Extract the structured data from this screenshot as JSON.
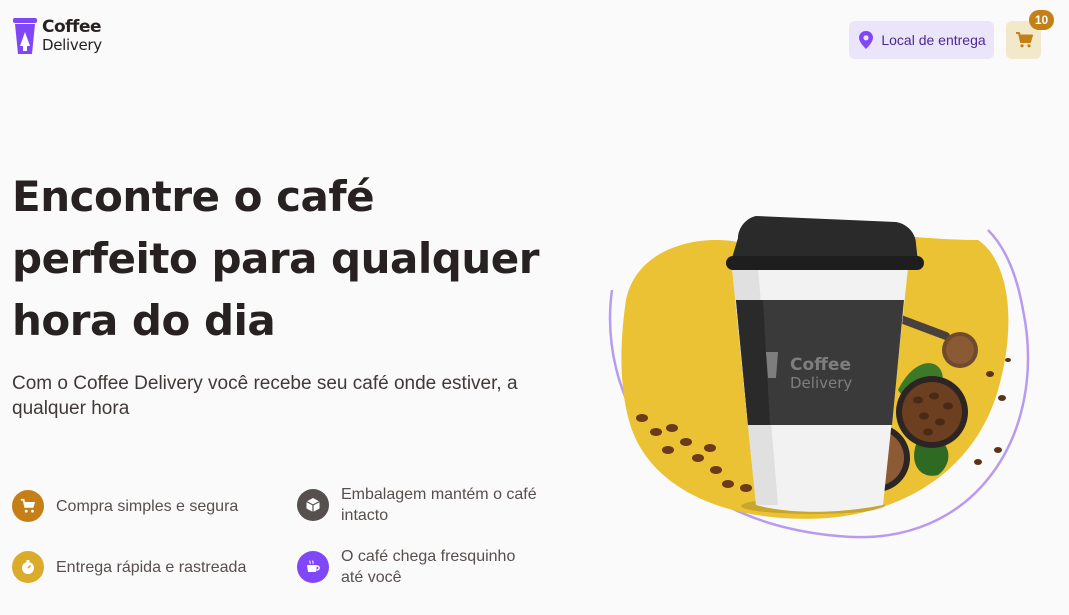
{
  "header": {
    "logo": {
      "line1": "Coffee",
      "line2": "Delivery"
    },
    "location_label": "Local de entrega",
    "cart_count": "10"
  },
  "hero": {
    "title_lines": [
      "Encontre o café",
      "perfeito para qualquer",
      "hora do dia"
    ],
    "subtitle": "Com o Coffee Delivery você recebe seu café onde estiver, a qualquer hora",
    "features": [
      {
        "label": "Compra simples e segura",
        "icon": "cart-icon",
        "color": "#C47F17"
      },
      {
        "label": "Embalagem mantém o café intacto",
        "icon": "package-icon",
        "color": "#574F4D"
      },
      {
        "label": "Entrega rápida e rastreada",
        "icon": "timer-icon",
        "color": "#DBAC2C"
      },
      {
        "label": "O café chega fresquinho até você",
        "icon": "coffee-icon",
        "color": "#8047F8"
      }
    ],
    "image_cup_label": {
      "line1": "Coffee",
      "line2": "Delivery"
    }
  },
  "colors": {
    "purple": "#8047F8",
    "purple_dark": "#4B2995",
    "purple_light": "#EBE5F9",
    "yellow": "#DBAC2C",
    "yellow_dark": "#C47F17",
    "yellow_light": "#F1E9C9"
  }
}
